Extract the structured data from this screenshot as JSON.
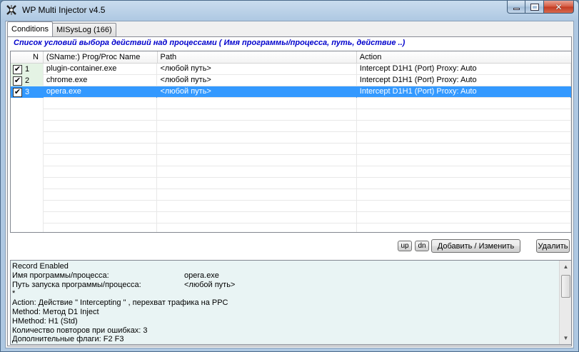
{
  "window": {
    "title": "WP Multi Injector v4.5"
  },
  "tabs": [
    {
      "label": "Conditions",
      "active": true
    },
    {
      "label": "MISysLog (166)",
      "active": false
    }
  ],
  "heading": "Список условий выбора действий над процессами ( Имя программы/процесса,  путь, действие ..)",
  "grid": {
    "columns": [
      "N",
      "(SName:) Prog/Proc Name",
      "Path",
      "Action"
    ],
    "rows": [
      {
        "n": "1",
        "checked": true,
        "name": "plugin-container.exe",
        "path": "<любой путь>",
        "action": "Intercept D1H1 (Port)  Proxy: Auto",
        "selected": false
      },
      {
        "n": "2",
        "checked": true,
        "name": "chrome.exe",
        "path": "<любой путь>",
        "action": "Intercept D1H1 (Port)  Proxy: Auto",
        "selected": false
      },
      {
        "n": "3",
        "checked": true,
        "name": "opera.exe",
        "path": "<любой путь>",
        "action": "Intercept D1H1 (Port)  Proxy: Auto",
        "selected": true
      }
    ]
  },
  "buttons": {
    "up": "up",
    "dn": "dn",
    "add_edit": "Добавить / Изменить",
    "delete": "Удалить"
  },
  "log": {
    "lines": [
      {
        "text": "Record Enabled",
        "value": ""
      },
      {
        "text": "Имя программы/процесса:",
        "value": "opera.exe"
      },
      {
        "text": "Путь запуска программы/процесса:",
        "value": "<любой путь>"
      },
      {
        "text": "*",
        "value": ""
      },
      {
        "text": "Action:   Действие \" Intercepting \" , перехват трафика на PPC",
        "value": ""
      },
      {
        "text": "Method:   Метод D1 Inject",
        "value": ""
      },
      {
        "text": "HMethod: H1 (Std)",
        "value": ""
      },
      {
        "text": "Количество повторов при ошибках: 3",
        "value": ""
      },
      {
        "text": "Дополнительные флаги: F2  F3",
        "value": ""
      },
      {
        "text": "*",
        "value": ""
      }
    ]
  },
  "colors": {
    "selection": "#3399ff",
    "heading": "#0000cc",
    "log_background": "#e9f4f4",
    "n_column": "#e4f3e4"
  },
  "icons": {
    "app": "injector-app-icon",
    "minimize": "minimize-icon",
    "maximize": "maximize-icon",
    "close": "close-icon"
  }
}
